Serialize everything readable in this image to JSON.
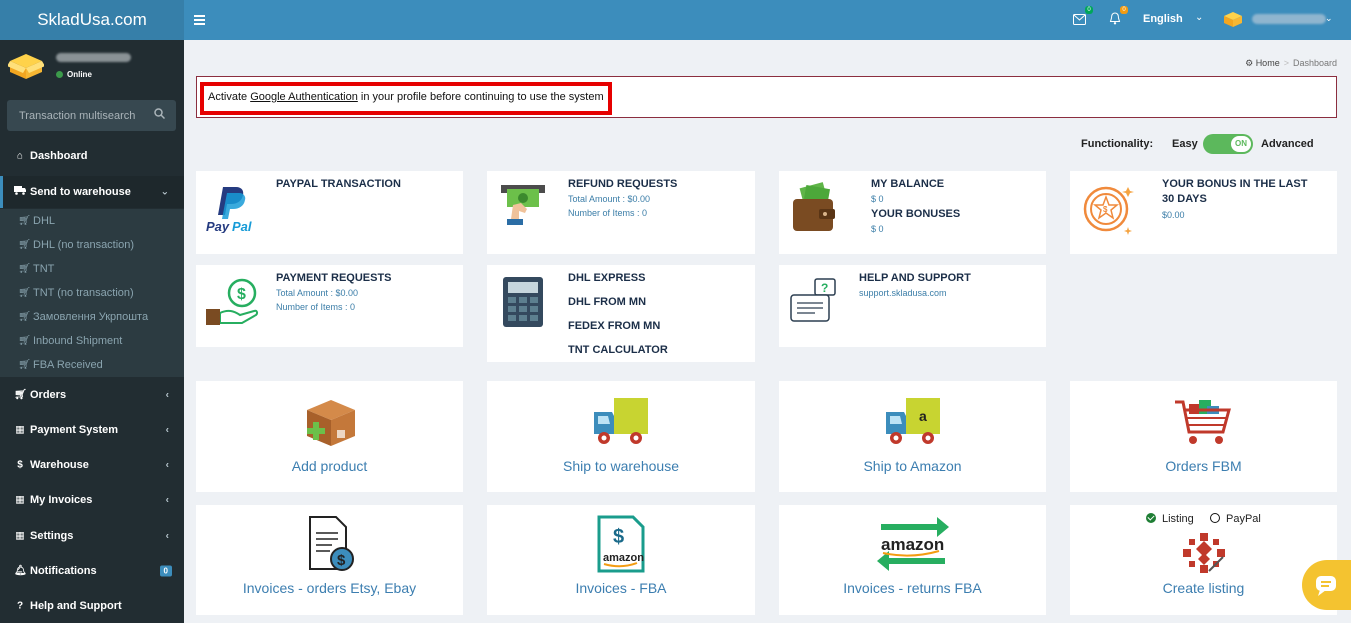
{
  "app": {
    "logo": "SkladUsa.com",
    "language": "English",
    "mail_badge": "0",
    "bell_badge": "0"
  },
  "sidebar": {
    "status": "Online",
    "search_placeholder": "Transaction multisearch",
    "items": [
      {
        "label": "Dashboard",
        "icon": "home-icon"
      },
      {
        "label": "Send to warehouse",
        "icon": "truck-icon"
      },
      {
        "label": "Orders",
        "icon": "basket-icon"
      },
      {
        "label": "Payment System",
        "icon": "grid-icon"
      },
      {
        "label": "Warehouse",
        "icon": "dollar-icon"
      },
      {
        "label": "My Invoices",
        "icon": "grid-icon"
      },
      {
        "label": "Settings",
        "icon": "grid-icon"
      },
      {
        "label": "Notifications",
        "icon": "bell-icon",
        "badge": "0"
      },
      {
        "label": "Help and Support",
        "icon": "question-icon"
      }
    ],
    "subitems": [
      "DHL",
      "DHL (no transaction)",
      "TNT",
      "TNT (no transaction)",
      "Замовлення Укрпошта",
      "Inbound Shipment",
      "FBA Received"
    ]
  },
  "breadcrumb": {
    "home": "Home",
    "current": "Dashboard"
  },
  "alert": {
    "before": "Activate ",
    "link": "Google Authentication",
    "after": " in your profile before continuing to use the system"
  },
  "functionality": {
    "label": "Functionality:",
    "easy": "Easy",
    "toggle": "ON",
    "advanced": "Advanced"
  },
  "cards": {
    "paypal": {
      "title": "PAYPAL TRANSACTION",
      "logo_pay": "Pay",
      "logo_pal": "Pal"
    },
    "refund": {
      "title": "REFUND REQUESTS",
      "line1": "Total Amount : $0.00",
      "line2": "Number of Items : 0"
    },
    "balance": {
      "title": "MY BALANCE",
      "value": "$ 0",
      "title2": "YOUR BONUSES",
      "value2": "$ 0"
    },
    "bonus": {
      "title": "YOUR BONUS IN THE LAST 30 DAYS",
      "value": "$0.00"
    },
    "payment": {
      "title": "PAYMENT REQUESTS",
      "line1": "Total Amount : $0.00",
      "line2": "Number of Items : 0"
    },
    "calc": {
      "l1": "DHL EXPRESS",
      "l2": "DHL FROM MN",
      "l3": "FEDEX FROM MN",
      "l4": "TNT CALCULATOR"
    },
    "help": {
      "title": "HELP AND SUPPORT",
      "email": "support.skladusa.com"
    }
  },
  "tiles": {
    "add_product": "Add product",
    "ship_warehouse": "Ship to warehouse",
    "ship_amazon": "Ship to Amazon",
    "orders_fbm": "Orders FBM",
    "inv_etsy": "Invoices - orders Etsy, Ebay",
    "inv_fba": "Invoices - FBA",
    "inv_returns": "Invoices - returns FBA",
    "create_listing": "Create listing",
    "radio_listing": "Listing",
    "radio_paypal": "PayPal",
    "amazon_word": "amazon",
    "amazon_a": "a"
  }
}
